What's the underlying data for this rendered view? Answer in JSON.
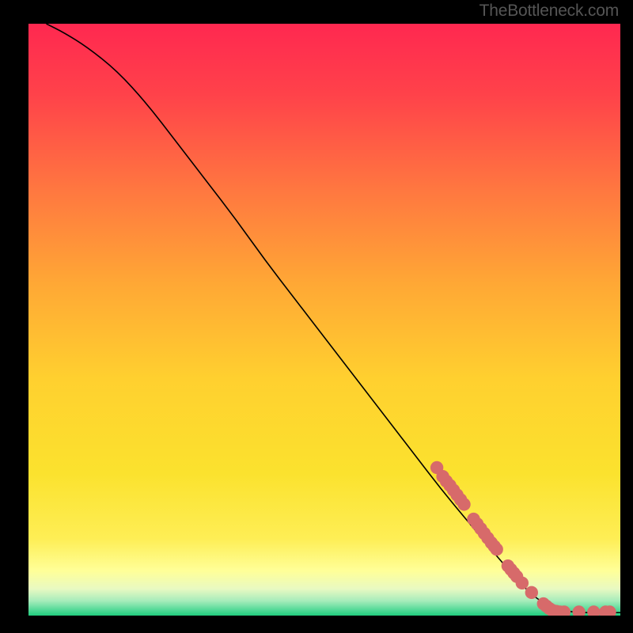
{
  "watermark": "TheBottleneck.com",
  "colors": {
    "curve": "#000000",
    "marker_fill": "#d76a6a",
    "marker_stroke": "#c85a5a",
    "gradient_top": "#ff2850",
    "gradient_mid": "#ffcc33",
    "gradient_bottom_y": "#ffff88",
    "gradient_green_light": "#b6f0bf",
    "gradient_green": "#2ed483"
  },
  "chart_data": {
    "type": "line",
    "title": "",
    "xlabel": "",
    "ylabel": "",
    "xlim": [
      0,
      100
    ],
    "ylim": [
      0,
      100
    ],
    "curve": [
      {
        "x": 3,
        "y": 100
      },
      {
        "x": 6,
        "y": 98.5
      },
      {
        "x": 10,
        "y": 96
      },
      {
        "x": 15,
        "y": 92
      },
      {
        "x": 20,
        "y": 86.5
      },
      {
        "x": 25,
        "y": 80
      },
      {
        "x": 30,
        "y": 73.5
      },
      {
        "x": 35,
        "y": 67
      },
      {
        "x": 40,
        "y": 60
      },
      {
        "x": 45,
        "y": 53.5
      },
      {
        "x": 50,
        "y": 47
      },
      {
        "x": 55,
        "y": 40.5
      },
      {
        "x": 60,
        "y": 34
      },
      {
        "x": 65,
        "y": 27.5
      },
      {
        "x": 70,
        "y": 21
      },
      {
        "x": 75,
        "y": 15
      },
      {
        "x": 80,
        "y": 9
      },
      {
        "x": 84,
        "y": 4.5
      },
      {
        "x": 86,
        "y": 2.8
      },
      {
        "x": 88,
        "y": 1.6
      },
      {
        "x": 90,
        "y": 0.9
      },
      {
        "x": 92,
        "y": 0.6
      },
      {
        "x": 94,
        "y": 0.5
      },
      {
        "x": 96,
        "y": 0.5
      },
      {
        "x": 98,
        "y": 0.5
      },
      {
        "x": 100,
        "y": 0.5
      }
    ],
    "markers": [
      {
        "x": 69.0,
        "y": 25.0
      },
      {
        "x": 70.0,
        "y": 23.5
      },
      {
        "x": 70.6,
        "y": 22.7
      },
      {
        "x": 71.2,
        "y": 22.0
      },
      {
        "x": 71.8,
        "y": 21.2
      },
      {
        "x": 72.4,
        "y": 20.4
      },
      {
        "x": 73.0,
        "y": 19.6
      },
      {
        "x": 73.6,
        "y": 18.8
      },
      {
        "x": 75.2,
        "y": 16.3
      },
      {
        "x": 75.8,
        "y": 15.5
      },
      {
        "x": 76.4,
        "y": 14.7
      },
      {
        "x": 77.0,
        "y": 13.9
      },
      {
        "x": 77.6,
        "y": 13.1
      },
      {
        "x": 78.2,
        "y": 12.3
      },
      {
        "x": 78.7,
        "y": 11.7
      },
      {
        "x": 79.1,
        "y": 11.2
      },
      {
        "x": 81.0,
        "y": 8.4
      },
      {
        "x": 81.5,
        "y": 7.8
      },
      {
        "x": 82.0,
        "y": 7.2
      },
      {
        "x": 82.5,
        "y": 6.6
      },
      {
        "x": 83.4,
        "y": 5.5
      },
      {
        "x": 85.0,
        "y": 3.9
      },
      {
        "x": 87.0,
        "y": 2.0
      },
      {
        "x": 87.5,
        "y": 1.6
      },
      {
        "x": 88.0,
        "y": 1.2
      },
      {
        "x": 88.5,
        "y": 0.9
      },
      {
        "x": 89.2,
        "y": 0.7
      },
      {
        "x": 89.8,
        "y": 0.6
      },
      {
        "x": 90.5,
        "y": 0.6
      },
      {
        "x": 93.0,
        "y": 0.6
      },
      {
        "x": 95.5,
        "y": 0.6
      },
      {
        "x": 97.5,
        "y": 0.6
      },
      {
        "x": 98.2,
        "y": 0.6
      }
    ],
    "marker_radius": 8.2
  }
}
